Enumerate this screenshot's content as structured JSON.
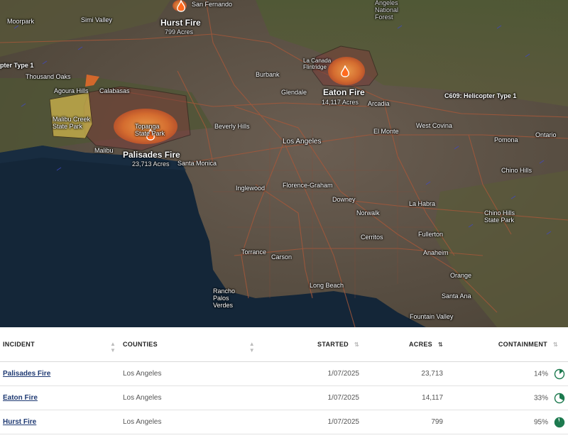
{
  "map": {
    "fires": [
      {
        "name": "Hurst Fire",
        "acres": "799 Acres"
      },
      {
        "name": "Eaton Fire",
        "acres": "14,117 Acres"
      },
      {
        "name": "Palisades Fire",
        "acres": "23,713 Acres"
      }
    ],
    "places": [
      "Simi Valley",
      "Moorpark",
      "Thousand Oaks",
      "Agoura Hills",
      "Calabasas",
      "Malibu Creek State Park",
      "Topanga State Park",
      "Malibu",
      "Santa Monica",
      "Beverly Hills",
      "Burbank",
      "Glendale",
      "La Canada Flintridge",
      "Arcadia",
      "Los Angeles",
      "El Monte",
      "West Covina",
      "Pomona",
      "Ontario",
      "Chino Hills",
      "Inglewood",
      "Florence-Graham",
      "Downey",
      "Norwalk",
      "La Habra",
      "Chino Hills State Park",
      "Torrance",
      "Carson",
      "Cerritos",
      "Fullerton",
      "Anaheim",
      "Orange",
      "Long Beach",
      "Rancho Palos Verdes",
      "Santa Ana",
      "Fountain Valley",
      "Angeles National Forest",
      "San Fernando"
    ],
    "aircraft": [
      "C609: Helicopter Type 1",
      "pter Type 1"
    ],
    "colors": {
      "perimeter": "#5b2a2a",
      "heat_high": "#f28a2e",
      "heat_mid": "#d96a2a",
      "zone": "#cbb54a"
    }
  },
  "table": {
    "headers": {
      "incident": "INCIDENT",
      "counties": "COUNTIES",
      "started": "STARTED",
      "acres": "ACRES",
      "containment": "CONTAINMENT"
    },
    "rows": [
      {
        "incident": "Palisades Fire",
        "counties": "Los Angeles",
        "started": "1/07/2025",
        "acres": "23,713",
        "containment": "14%",
        "containment_value": 14
      },
      {
        "incident": "Eaton Fire",
        "counties": "Los Angeles",
        "started": "1/07/2025",
        "acres": "14,117",
        "containment": "33%",
        "containment_value": 33
      },
      {
        "incident": "Hurst Fire",
        "counties": "Los Angeles",
        "started": "1/07/2025",
        "acres": "799",
        "containment": "95%",
        "containment_value": 95
      }
    ],
    "sort_column": "acres",
    "pie_color": "#1d7a4f"
  }
}
